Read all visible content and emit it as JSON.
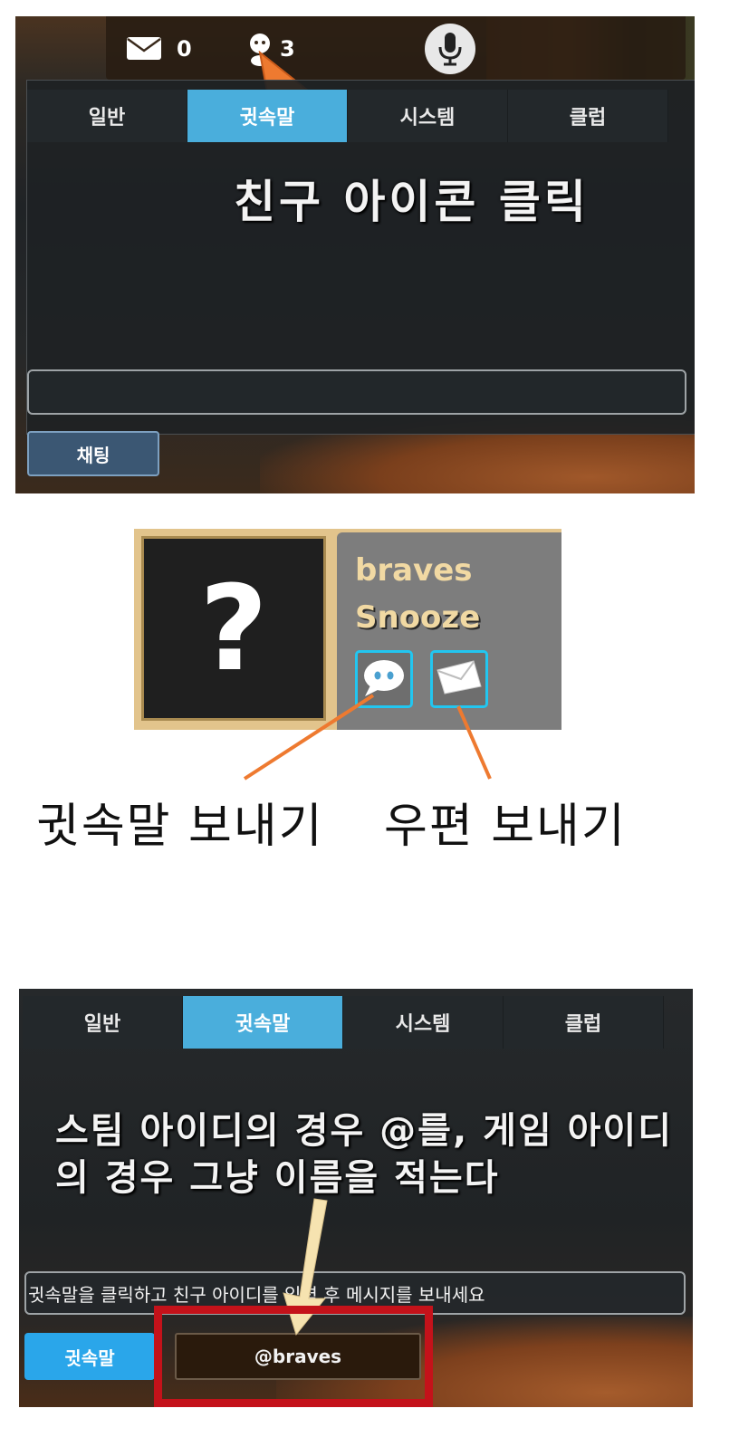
{
  "panel1": {
    "mail_count": "0",
    "friend_count": "3",
    "icons": {
      "mail": "mail-icon",
      "friend": "friend-icon",
      "mic": "microphone-icon"
    },
    "tabs": [
      "일반",
      "귓속말",
      "시스템",
      "클럽"
    ],
    "active_tab": "귓속말",
    "annotation": "친구 아이콘 클릭",
    "chat_button": "채팅",
    "input_value": ""
  },
  "panel2": {
    "avatar_placeholder": "?",
    "name": "braves",
    "status": "Snooze",
    "icons": {
      "whisper": "chat-bubble-icon",
      "mail": "mail-icon"
    },
    "caption_whisper": "귓속말 보내기",
    "caption_mail": "우편 보내기"
  },
  "panel3": {
    "tabs": [
      "일반",
      "귓속말",
      "시스템",
      "클럽"
    ],
    "active_tab": "귓속말",
    "annotation_line1": "스팀 아이디의 경우 @를, 게임 아이디",
    "annotation_line2": "의 경우 그냥 이름을 적는다",
    "input_text": "귓속말을 클릭하고 친구 아이디를 입력 후 메시지를 보내세요",
    "whisper_button": "귓속말",
    "target_value": "@braves"
  },
  "colors": {
    "active_tab": "#4aaedc",
    "highlight_box": "#c4121a",
    "arrow_orange": "#ee7a30",
    "arrow_cream": "#f6e3b0",
    "icon_border": "#22c6f0"
  }
}
